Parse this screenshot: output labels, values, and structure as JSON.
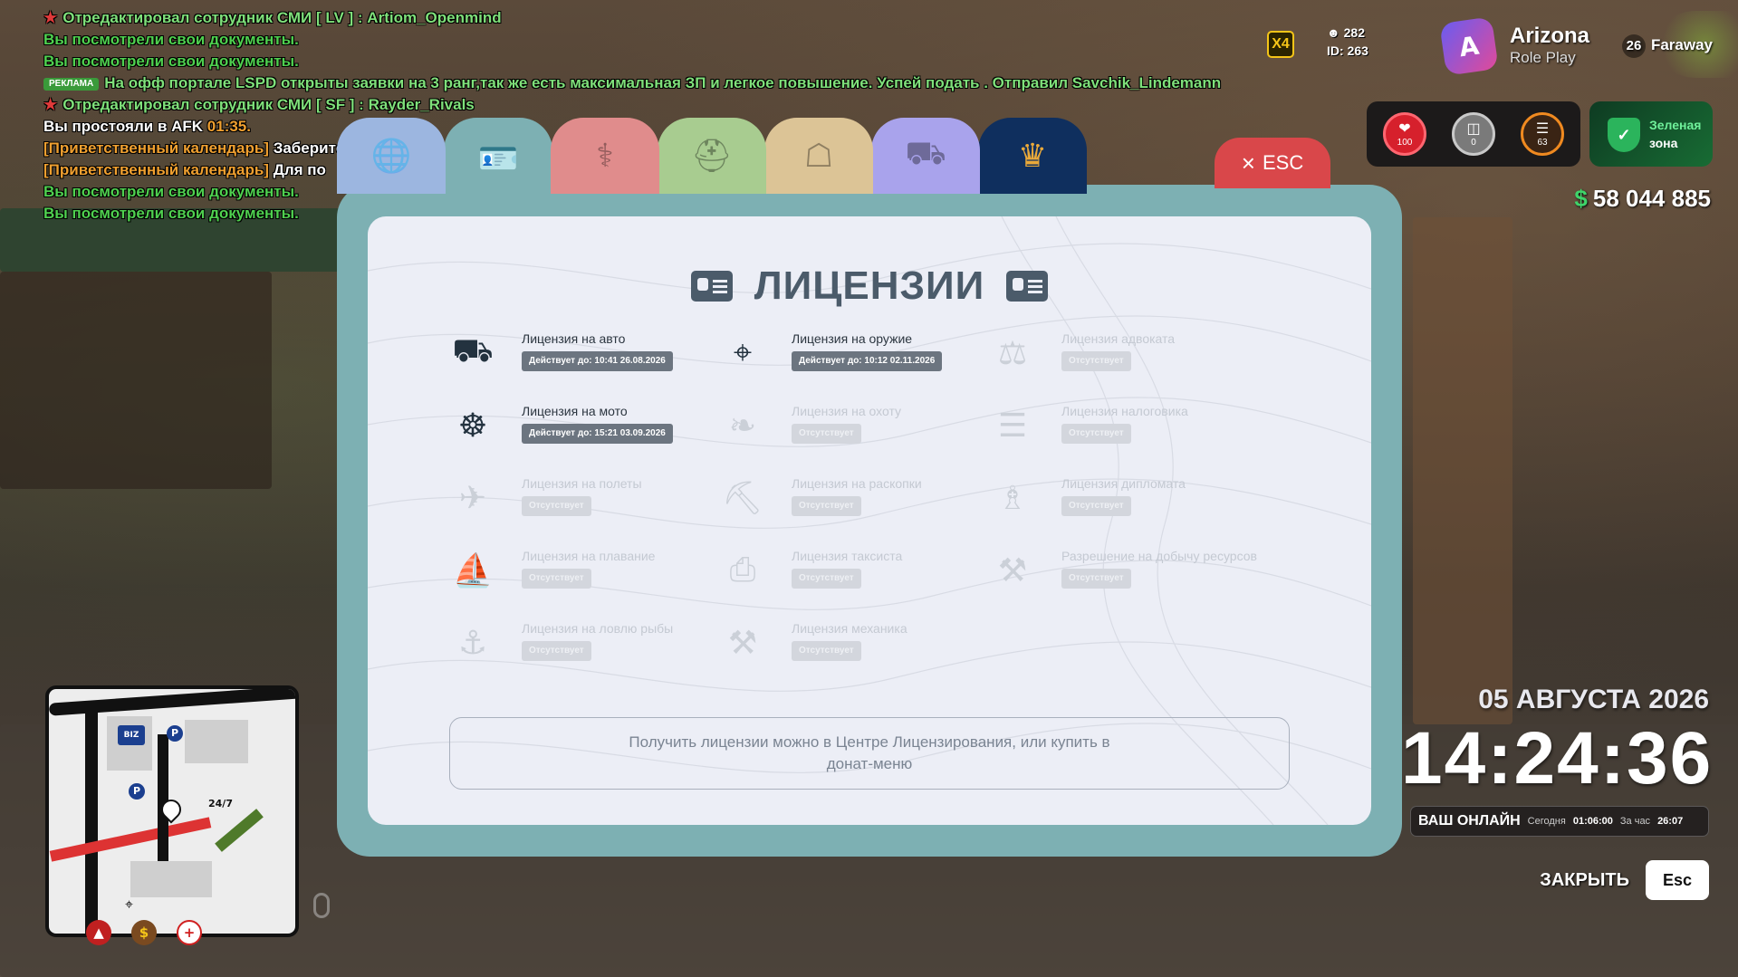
{
  "chat": [
    {
      "pin": true,
      "ad": false,
      "parts": [
        {
          "t": "Отредактировал сотрудник СМИ [ LV ] : Artiom_Openmind",
          "c": "#7fe07a"
        }
      ]
    },
    {
      "pin": false,
      "ad": false,
      "parts": [
        {
          "t": "Вы посмотрели свои документы.",
          "c": "#4fd04f"
        }
      ]
    },
    {
      "pin": false,
      "ad": false,
      "parts": [
        {
          "t": "Вы посмотрели свои документы.",
          "c": "#4fd04f"
        }
      ]
    },
    {
      "pin": false,
      "ad": true,
      "parts": [
        {
          "t": "На офф портале LSPD открыты заявки на 3 ранг,так же есть максимальная ЗП и легкое повышение. Успей подать . Отправил Savchik_Lindemann",
          "c": "#7fe07a"
        }
      ]
    },
    {
      "pin": true,
      "ad": false,
      "parts": [
        {
          "t": "Отредактировал сотрудник СМИ [ SF ] : Rayder_Rivals",
          "c": "#7fe07a"
        }
      ]
    },
    {
      "pin": false,
      "ad": false,
      "parts": [
        {
          "t": "Вы простояли в AFK ",
          "c": "#ffffff"
        },
        {
          "t": "01:35.",
          "c": "#f0a030"
        }
      ]
    },
    {
      "pin": false,
      "ad": false,
      "parts": [
        {
          "t": "[Приветственный календарь] ",
          "c": "#f0a030"
        },
        {
          "t": "Заберите",
          "c": "#ffffff"
        }
      ]
    },
    {
      "pin": false,
      "ad": false,
      "parts": [
        {
          "t": "[Приветственный календарь] ",
          "c": "#f0a030"
        },
        {
          "t": "Для по",
          "c": "#ffffff"
        }
      ]
    },
    {
      "pin": false,
      "ad": false,
      "parts": [
        {
          "t": "Вы посмотрели свои документы.",
          "c": "#4fd04f"
        }
      ]
    },
    {
      "pin": false,
      "ad": false,
      "parts": [
        {
          "t": "Вы посмотрели свои документы.",
          "c": "#4fd04f"
        }
      ]
    }
  ],
  "ad_badge": "РЕКЛАМА",
  "hud": {
    "multiplier": "X4",
    "players": "282",
    "id_label": "ID: 263",
    "brand_title": "Arizona",
    "brand_subtitle": "Role Play",
    "server_num": "26",
    "server_name": "Faraway",
    "health": "100",
    "armor": "0",
    "hunger": "63",
    "zone_line1": "Зеленая",
    "zone_line2": "зона",
    "money_symbol": "$",
    "money": "58 044 885",
    "date": "05 АВГУСТА 2026",
    "time": "14:24:36",
    "online_label": "ВАШ ОНЛАЙН",
    "today_label": "Сегодня",
    "today_value": "01:06:00",
    "hour_label": "За час",
    "hour_value": "26:07",
    "close_label": "ЗАКРЫТЬ",
    "close_key": "Esc"
  },
  "colors": {
    "window": "#7db0b3",
    "card": "#eceef6",
    "esc": "#d9474a",
    "tabs": [
      "#9cb6e0",
      "#7db0b3",
      "#e08c8c",
      "#a8cc90",
      "#dcc496",
      "#a9a3ec",
      "#0f2f5e"
    ]
  },
  "tabs": [
    {
      "icon": "passport-icon",
      "glyph": "🌐",
      "active": false
    },
    {
      "icon": "id-card-icon",
      "glyph": "🪪",
      "active": true
    },
    {
      "icon": "medical-caduceus-icon",
      "glyph": "⚕",
      "active": false
    },
    {
      "icon": "military-helmet-icon",
      "glyph": "⛑",
      "active": false
    },
    {
      "icon": "property-buildings-icon",
      "glyph": "☖",
      "active": false
    },
    {
      "icon": "car-icon",
      "glyph": "⛟",
      "active": false
    },
    {
      "icon": "crown-icon",
      "glyph": "♛",
      "active": false
    }
  ],
  "esc_label": "ESC",
  "title": "ЛИЦЕНЗИИ",
  "licenses": [
    {
      "name": "Лицензия на авто",
      "status": "Действует до: 10:41 26.08.2026",
      "active": true,
      "icon": "car-icon",
      "glyph": "⛟"
    },
    {
      "name": "Лицензия на оружие",
      "status": "Действует до: 10:12 02.11.2026",
      "active": true,
      "icon": "pistol-icon",
      "glyph": "⌖"
    },
    {
      "name": "Лицензия адвоката",
      "status": "Отсутствует",
      "active": false,
      "icon": "gavel-icon",
      "glyph": "⚖"
    },
    {
      "name": "Лицензия на мото",
      "status": "Действует до: 15:21 03.09.2026",
      "active": true,
      "icon": "motorcycle-icon",
      "glyph": "☸"
    },
    {
      "name": "Лицензия на охоту",
      "status": "Отсутствует",
      "active": false,
      "icon": "deer-icon",
      "glyph": "❧"
    },
    {
      "name": "Лицензия налоговика",
      "status": "Отсутствует",
      "active": false,
      "icon": "tax-document-icon",
      "glyph": "☰"
    },
    {
      "name": "Лицензия на полеты",
      "status": "Отсутствует",
      "active": false,
      "icon": "airplane-icon",
      "glyph": "✈"
    },
    {
      "name": "Лицензия на раскопки",
      "status": "Отсутствует",
      "active": false,
      "icon": "shovel-icon",
      "glyph": "⛏"
    },
    {
      "name": "Лицензия дипломата",
      "status": "Отсутствует",
      "active": false,
      "icon": "podium-icon",
      "glyph": "♗"
    },
    {
      "name": "Лицензия на плавание",
      "status": "Отсутствует",
      "active": false,
      "icon": "sailboat-icon",
      "glyph": "⛵"
    },
    {
      "name": "Лицензия таксиста",
      "status": "Отсутствует",
      "active": false,
      "icon": "taxi-icon",
      "glyph": "⎙"
    },
    {
      "name": "Разрешение на добычу ресурсов",
      "status": "Отсутствует",
      "active": false,
      "icon": "pickaxe-icon",
      "glyph": "⚒"
    },
    {
      "name": "Лицензия на ловлю рыбы",
      "status": "Отсутствует",
      "active": false,
      "icon": "fish-hook-icon",
      "glyph": "⚓"
    },
    {
      "name": "Лицензия механика",
      "status": "Отсутствует",
      "active": false,
      "icon": "wrench-icon",
      "glyph": "⚒"
    }
  ],
  "info_text": "Получить лицензии можно в Центре Лицензирования, или купить в донат-меню",
  "minimap": {
    "biz": "BIZ",
    "p": "P",
    "shop": "24/7"
  }
}
